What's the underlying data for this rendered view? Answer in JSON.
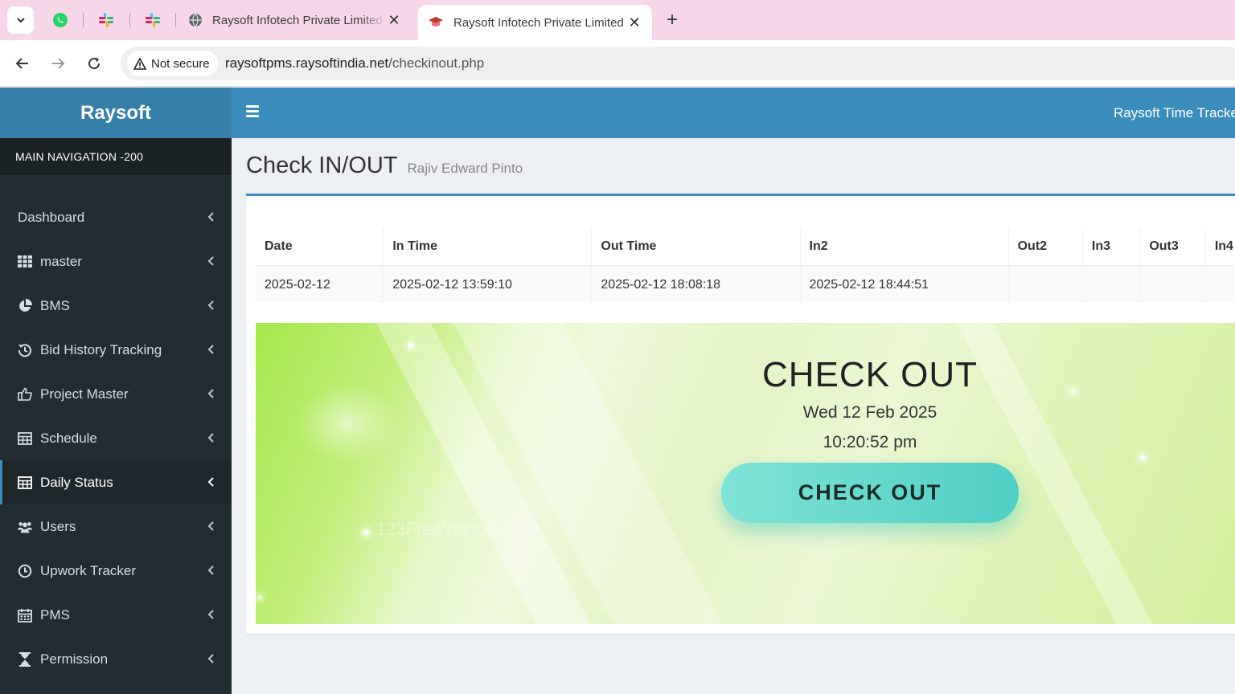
{
  "browser": {
    "tabs": [
      {
        "title": "Raysoft Infotech Private Limited",
        "active": false,
        "icon": "globe-icon"
      },
      {
        "title": "Raysoft Infotech Private Limited",
        "active": true,
        "icon": "graduation-cap-icon"
      }
    ],
    "pinned_tabs": [
      "whatsapp-icon",
      "slack-icon",
      "slack-icon"
    ],
    "security_label": "Not secure",
    "url_host": "raysoftpms.raysoftindia.net",
    "url_path": "/checkinout.php"
  },
  "app": {
    "logo": "Raysoft",
    "header_title": "Raysoft Time Tracker"
  },
  "sidebar": {
    "header": "MAIN NAVIGATION -200",
    "items": [
      {
        "label": "Dashboard",
        "icon": "none",
        "active": false
      },
      {
        "label": "master",
        "icon": "grid-icon",
        "active": false
      },
      {
        "label": "BMS",
        "icon": "pie-chart-icon",
        "active": false
      },
      {
        "label": "Bid History Tracking",
        "icon": "history-icon",
        "active": false
      },
      {
        "label": "Project Master",
        "icon": "thumbs-up-icon",
        "active": false
      },
      {
        "label": "Schedule",
        "icon": "table-icon",
        "active": false
      },
      {
        "label": "Daily Status",
        "icon": "table-icon",
        "active": true
      },
      {
        "label": "Users",
        "icon": "users-icon",
        "active": false
      },
      {
        "label": "Upwork Tracker",
        "icon": "clock-icon",
        "active": false
      },
      {
        "label": "PMS",
        "icon": "calendar-icon",
        "active": false
      },
      {
        "label": "Permission",
        "icon": "hourglass-icon",
        "active": false
      }
    ]
  },
  "page": {
    "title": "Check IN/OUT",
    "subtitle": "Rajiv Edward Pinto"
  },
  "table": {
    "columns": [
      "Date",
      "In Time",
      "Out Time",
      "In2",
      "Out2",
      "In3",
      "Out3",
      "In4"
    ],
    "rows": [
      [
        "2025-02-12",
        "2025-02-12 13:59:10",
        "2025-02-12 18:08:18",
        "2025-02-12 18:44:51",
        "",
        "",
        "",
        ""
      ]
    ]
  },
  "banner": {
    "title": "CHECK OUT",
    "date": "Wed 12 Feb 2025",
    "time": "10:20:52 pm",
    "button_label": "CHECK OUT",
    "watermark": "123FreeVectors.com"
  },
  "colors": {
    "header_blue": "#3c8dbc",
    "logo_blue": "#367fa9",
    "sidebar_dark": "#222d32",
    "button_teal": "#5fd6cb",
    "banner_green": "#a4e84a"
  }
}
